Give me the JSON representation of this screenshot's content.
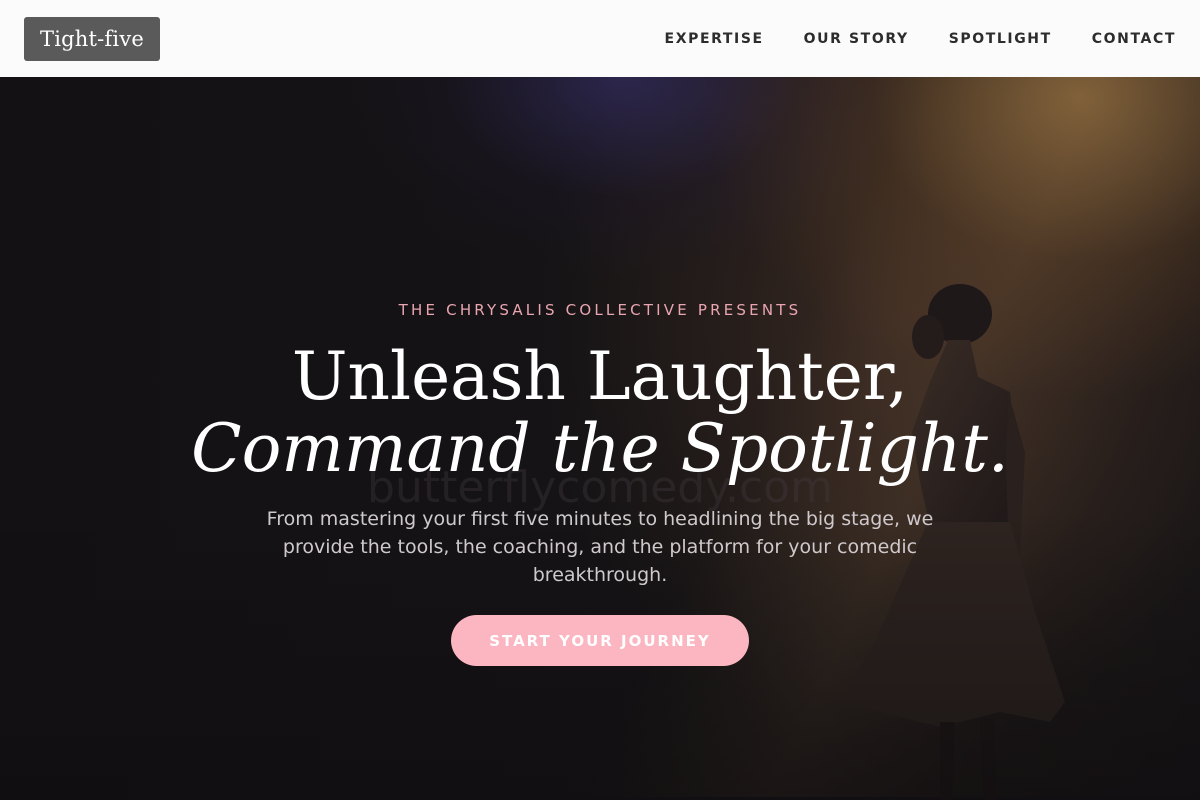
{
  "header": {
    "logo": "Tight-five",
    "nav": [
      {
        "label": "EXPERTISE"
      },
      {
        "label": "OUR STORY"
      },
      {
        "label": "SPOTLIGHT"
      },
      {
        "label": "CONTACT"
      }
    ]
  },
  "hero": {
    "eyebrow": "THE CHRYSALIS COLLECTIVE PRESENTS",
    "headline_line1": "Unleash Laughter,",
    "headline_line2": "Command the Spotlight.",
    "watermark": "butterflycomedy.com",
    "subtext": "From mastering your first five minutes to headlining the big stage, we provide the tools, the coaching, and the platform for your comedic breakthrough.",
    "cta_label": "START YOUR JOURNEY"
  },
  "colors": {
    "header_bg": "#fcfbfc",
    "logo_bg": "#5a5a5a",
    "accent_pink": "#fbb6c1",
    "eyebrow_pink": "#e9a5b0",
    "hero_bg": "#161416"
  }
}
